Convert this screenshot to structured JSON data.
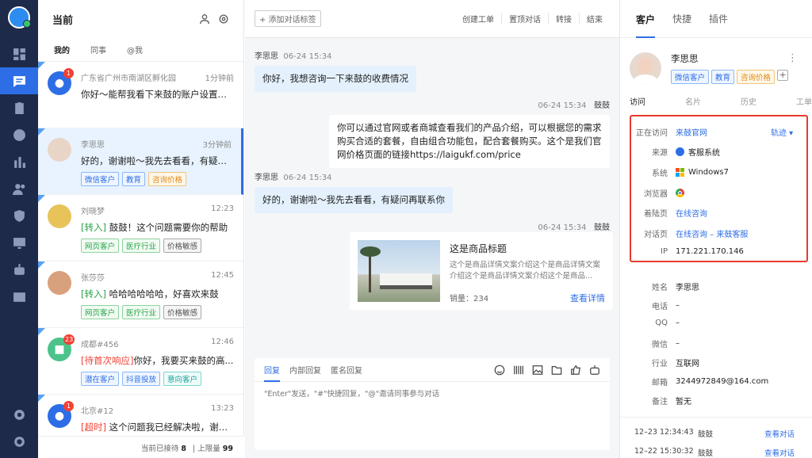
{
  "nav": {
    "items": [
      "dashboard-icon",
      "chat-icon",
      "clipboard-icon",
      "clock-icon",
      "bar-chart-icon",
      "users-icon",
      "shield-icon",
      "monitor-icon",
      "robot-icon",
      "mail-icon"
    ],
    "bottom": [
      "gear-icon",
      "logout-icon"
    ],
    "active": 1
  },
  "list": {
    "title": "当前",
    "tabs": [
      "我的",
      "同事",
      "@我"
    ],
    "conversations": [
      {
        "name": "广东省广州市南湖区孵化园",
        "time": "1分钟前",
        "msg": "你好～能帮我看下来鼓的账户设置吗...",
        "badge": "1",
        "avatar": "paw-icon",
        "tags": []
      },
      {
        "name": "李思思",
        "time": "3分钟前",
        "msg": "好的，谢谢啦～我先去看看，有疑问...",
        "badge": "",
        "avatar": "photo",
        "tags": [
          {
            "t": "微信客户",
            "c": "blue"
          },
          {
            "t": "教育",
            "c": "blue"
          },
          {
            "t": "咨询价格",
            "c": "orange"
          }
        ]
      },
      {
        "name": "刘晓梦",
        "time": "12:23",
        "prefix": "[转入]",
        "prefix_color": "green",
        "msg": "鼓鼓！这个问题需要你的帮助",
        "badge": "",
        "avatar": "photo",
        "tags": [
          {
            "t": "网页客户",
            "c": "green"
          },
          {
            "t": "医疗行业",
            "c": "green"
          },
          {
            "t": "价格敏感",
            "c": "gray"
          }
        ]
      },
      {
        "name": "张莎莎",
        "time": "12:45",
        "prefix": "[转入]",
        "prefix_color": "green",
        "msg": "哈哈哈哈哈哈，好喜欢来鼓",
        "badge": "",
        "avatar": "photo",
        "tags": [
          {
            "t": "网页客户",
            "c": "green"
          },
          {
            "t": "医疗行业",
            "c": "green"
          },
          {
            "t": "价格敏感",
            "c": "gray"
          }
        ]
      },
      {
        "name": "成都#456",
        "time": "12:46",
        "prefix": "[待首次响应]",
        "prefix_color": "red",
        "msg": "你好，我要买来鼓的高...",
        "badge": "23",
        "avatar": "robot-icon",
        "tags": [
          {
            "t": "潜在客户",
            "c": "blue"
          },
          {
            "t": "抖音投放",
            "c": "blue"
          },
          {
            "t": "意向客户",
            "c": "teal"
          }
        ]
      },
      {
        "name": "北京#12",
        "time": "13:23",
        "prefix": "[超时]",
        "prefix_color": "red",
        "msg": "这个问题我已经解决啦，谢谢...",
        "badge": "1",
        "avatar": "paw-icon",
        "tags": []
      }
    ],
    "footer": {
      "reception_label": "当前已接待",
      "reception": "8",
      "limit_label": "上限量",
      "limit": "99"
    }
  },
  "chat": {
    "add_tag": "+ 添加对话标签",
    "actions": [
      "创建工单",
      "置顶对话",
      "转接",
      "结束"
    ],
    "messages": [
      {
        "who": "李思思",
        "time": "06-24 15:34",
        "text": "你好，我想咨询一下来鼓的收费情况",
        "side": "left"
      },
      {
        "who": "鼓鼓",
        "time": "06-24 15:34",
        "text": "你可以通过官网或者商城查看我们的产品介绍，可以根据您的需求购买合适的套餐，自由组合功能包，配合套餐购买。这个是我们官网价格页面的链接https://laigukf.com/price",
        "side": "right"
      },
      {
        "who": "李思思",
        "time": "06-24 15:34",
        "text": "好的，谢谢啦～我先去看看，有疑问再联系你",
        "side": "left"
      },
      {
        "who": "鼓鼓",
        "time": "06-24 15:34",
        "side": "right"
      }
    ],
    "card": {
      "title": "这是商品标题",
      "desc": "这个是商品详情文案介绍这个是商品详情文案介绍这个是商品详情文案介绍这个是商品...",
      "sales": "销量：234",
      "link": "查看详情"
    },
    "composer": {
      "tabs": [
        "回复",
        "内部回复",
        "匿名回复"
      ],
      "placeholder": "\"Enter\"发送，\"#\"快捷回复，\"@\"邀请同事参与对话",
      "tools": [
        "smile-icon",
        "barcode-icon",
        "image-icon",
        "folder-icon",
        "thumb-up-icon",
        "robot-icon"
      ]
    }
  },
  "side": {
    "tabs": [
      "客户",
      "快捷",
      "插件"
    ],
    "profile": {
      "name": "李思思",
      "tags": [
        {
          "t": "微信客户",
          "c": "blue"
        },
        {
          "t": "教育",
          "c": "blue"
        },
        {
          "t": "咨询价格",
          "c": "orange"
        }
      ],
      "more": "⋮"
    },
    "subtabs": [
      "访问",
      "名片",
      "历史",
      "工单"
    ],
    "visit": [
      {
        "k": "正在访问",
        "v": "来鼓官网",
        "link": true
      },
      {
        "k": "来源",
        "v": "客服系统",
        "icon": "paw-icon"
      },
      {
        "k": "系统",
        "v": "Windows7",
        "icon": "windows-icon"
      },
      {
        "k": "浏览器",
        "v": "",
        "icon": "chrome-icon"
      },
      {
        "k": "着陆页",
        "v": "在线咨询",
        "link": true
      },
      {
        "k": "对话页",
        "v": "在线咨询 – 来鼓客服",
        "link": true
      },
      {
        "k": "IP",
        "v": "171.221.170.146"
      }
    ],
    "track": "轨迹 ▾",
    "info": [
      {
        "k": "姓名",
        "v": "李思思"
      },
      {
        "k": "电话",
        "v": "–"
      },
      {
        "k": "QQ",
        "v": "–"
      },
      {
        "k": "微信",
        "v": "–"
      },
      {
        "k": "行业",
        "v": "互联网"
      },
      {
        "k": "邮箱",
        "v": "3244972849@164.com"
      },
      {
        "k": "备注",
        "v": "暂无"
      }
    ],
    "history": [
      {
        "time": "12–23 12:34:43",
        "name": "鼓鼓",
        "action": "查看对话"
      },
      {
        "time": "12–22 15:30:32",
        "name": "鼓鼓",
        "action": "查看对话"
      }
    ]
  }
}
